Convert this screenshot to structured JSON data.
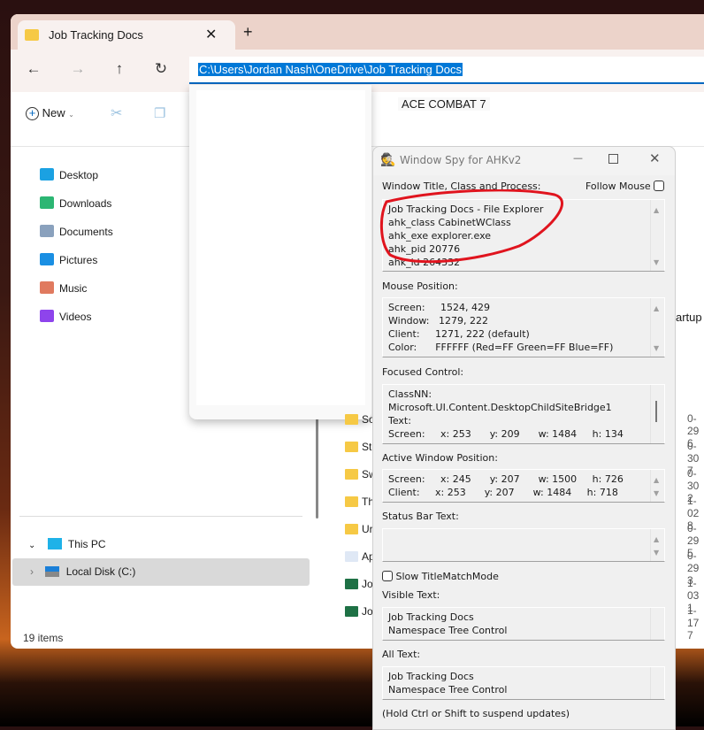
{
  "explorer": {
    "tab_title": "Job Tracking Docs",
    "new_tab": "+",
    "address": "C:\\Users\\Jordan Nash\\OneDrive\\Job Tracking Docs",
    "suggestion": "ACE COMBAT 7",
    "new_label": "New",
    "sidebar": [
      {
        "label": "Desktop",
        "icon": "desktop-icon",
        "color": "#1ba1e2"
      },
      {
        "label": "Downloads",
        "icon": "download-icon",
        "color": "#2cb673"
      },
      {
        "label": "Documents",
        "icon": "documents-icon",
        "color": "#8aa1bd"
      },
      {
        "label": "Pictures",
        "icon": "pictures-icon",
        "color": "#1a8fe3"
      },
      {
        "label": "Music",
        "icon": "music-icon",
        "color": "#e07a5f"
      },
      {
        "label": "Videos",
        "icon": "videos-icon",
        "color": "#8e44ec"
      }
    ],
    "this_pc": "This PC",
    "local_disk": "Local Disk (C:)",
    "status": "19 items",
    "files": [
      {
        "name": "So",
        "date": "0-29 6",
        "type": "folder"
      },
      {
        "name": "St",
        "date": "0-30 7",
        "type": "folder"
      },
      {
        "name": "Sw",
        "date": "0-30 2",
        "type": "folder"
      },
      {
        "name": "Th",
        "date": "1-02 8",
        "type": "folder"
      },
      {
        "name": "Ur",
        "date": "0-29 5",
        "type": "folder"
      },
      {
        "name": "Ap",
        "date": "0-29 3",
        "type": "file"
      },
      {
        "name": "Jo",
        "date": "1-03 1",
        "type": "excel"
      },
      {
        "name": "Jo",
        "date": "1-17 7",
        "type": "excel-shortcut"
      }
    ],
    "fragment": "artup"
  },
  "spy": {
    "title": "Window Spy for AHKv2",
    "window_label": "Window Title, Class and Process:",
    "follow_mouse": "Follow Mouse",
    "window_info": "Job Tracking Docs - File Explorer\nahk_class CabinetWClass\nahk_exe explorer.exe\nahk_pid 20776\nahk_id 264332",
    "mouse_label": "Mouse Position:",
    "mouse_info": "Screen:     1524, 429\nWindow:   1279, 222\nClient:     1271, 222 (default)\nColor:      FFFFFF (Red=FF Green=FF Blue=FF)",
    "focused_label": "Focused Control:",
    "focused_info": "ClassNN:\nMicrosoft.UI.Content.DesktopChildSiteBridge1\nText:\nScreen:     x: 253      y: 209      w: 1484     h: 134",
    "active_label": "Active Window Position:",
    "active_info": "Screen:     x: 245      y: 207      w: 1500     h: 726\nClient:     x: 253      y: 207      w: 1484     h: 718",
    "status_label": "Status Bar Text:",
    "status_info": "",
    "slow_mode": "Slow TitleMatchMode",
    "visible_label": "Visible Text:",
    "visible_info": "Job Tracking Docs\nNamespace Tree Control",
    "all_label": "All Text:",
    "all_info": "Job Tracking Docs\nNamespace Tree Control",
    "footer": "(Hold Ctrl or Shift to suspend updates)",
    "annotation_color": "#e0141e"
  }
}
